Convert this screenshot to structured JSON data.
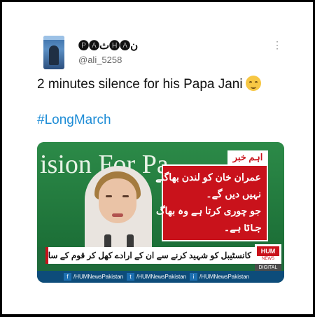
{
  "tweet": {
    "display_name": "🅟🅐ث🅗🅐ن",
    "handle": "@ali_5258",
    "more_icon": "⋮",
    "text": "2 minutes silence for his Papa Jani",
    "emoji": "relieved-face-emoji",
    "hashtag": "#LongMarch"
  },
  "media": {
    "background_text": "ision For Pa",
    "news_tag": "اہم خبر",
    "news_lines": [
      "عمران خان کو لندن بھاگنے",
      "نہیں دیں گے۔",
      "جو چوری کرتا ہے وہ بھاگ",
      "جاتا ہے۔"
    ],
    "ticker_text": "کانسٹیبل کو شہید کرنے سے ان کے ارادے کھل کر قوم کے سامنے آگئے، مریم نواز",
    "logo": {
      "name": "HUM",
      "sub": "NEWS",
      "digital": "DIGITAL"
    },
    "social": [
      {
        "icon": "f",
        "label": "/HUMNewsPakistan"
      },
      {
        "icon": "t",
        "label": "/HUMNewsPakistan"
      },
      {
        "icon": "i",
        "label": "/HUMNewsPakistan"
      }
    ]
  }
}
